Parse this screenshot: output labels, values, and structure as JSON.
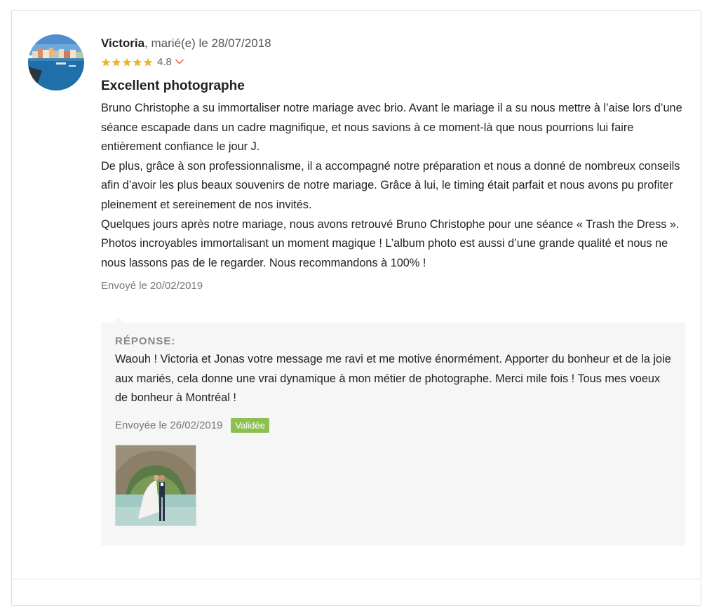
{
  "review": {
    "reviewer_name": "Victoria",
    "married_text": ", marié(e) le 28/07/2018",
    "rating": "4.8",
    "stars_filled": 5,
    "title": "Excellent photographe",
    "body": "Bruno Christophe a su immortaliser notre mariage avec brio. Avant le mariage il a su nous mettre à l’aise lors d’une séance escapade dans un cadre magnifique, et nous savions à ce moment-là que nous pourrions lui faire entièrement confiance le jour J.\nDe plus, grâce à son professionnalisme, il a accompagné notre préparation et nous a donné de nombreux conseils afin d’avoir les plus beaux souvenirs de notre mariage. Grâce à lui, le timing était parfait et nous avons pu profiter pleinement et sereinement de nos invités.\nQuelques jours après notre mariage, nous avons retrouvé Bruno Christophe pour une séance « Trash the Dress ». Photos incroyables immortalisant un moment magique ! L’album photo est aussi d’une grande qualité et nous ne nous lassons pas de le regarder. Nous recommandons à 100% !",
    "sent_date": "Envoyé le 20/02/2019"
  },
  "reply": {
    "label": "RÉPONSE:",
    "body": "Waouh ! Victoria et Jonas votre message me ravi et me motive énormément. Apporter du bonheur et de la joie aux mariés, cela donne une vrai dynamique à mon métier de photographe. Merci mile fois ! Tous mes voeux de bonheur à Montréal !",
    "sent_date": "Envoyée le 26/02/2019",
    "status_badge": "Validée"
  },
  "colors": {
    "star": "#f0b429",
    "badge": "#8cc152",
    "chevron": "#e8574c",
    "reply_bg": "#f6f6f6"
  },
  "icons": {
    "star": "star-icon",
    "chevron": "chevron-down-icon"
  }
}
